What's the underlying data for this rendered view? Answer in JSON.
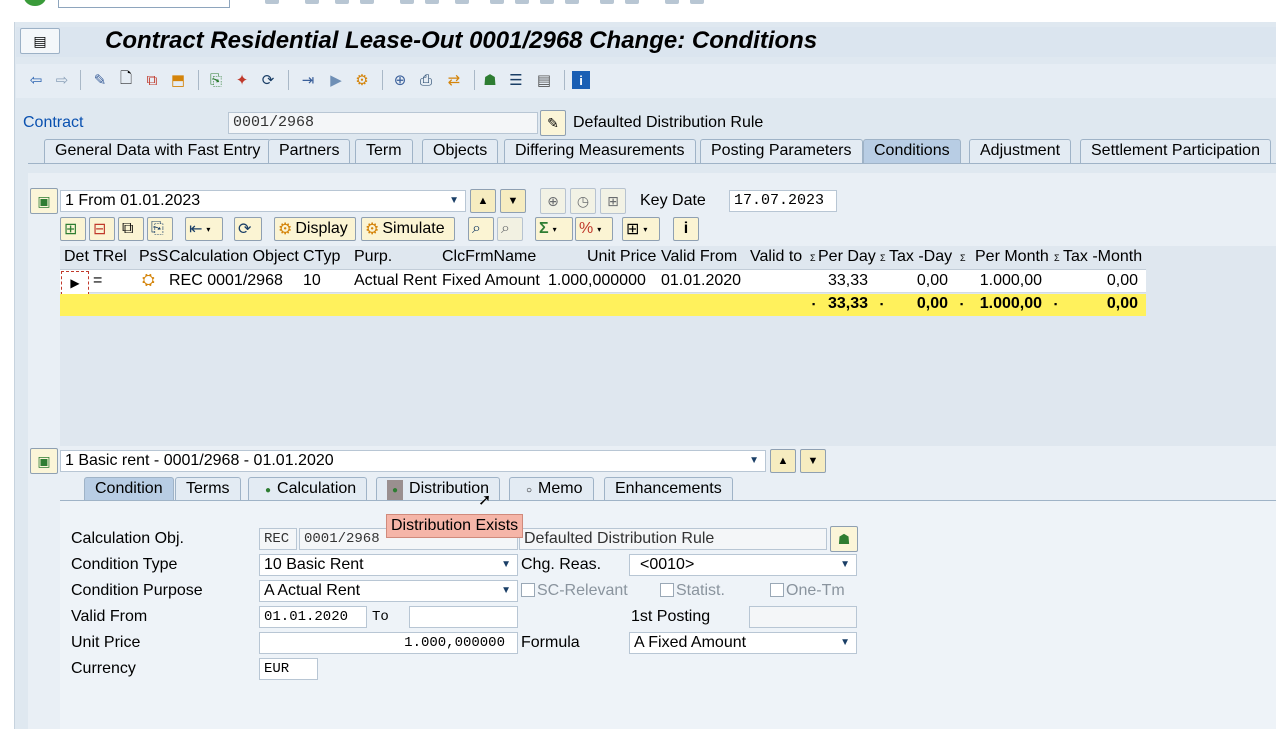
{
  "window": {
    "title": "Contract Residential Lease-Out 0001/2968 Change: Conditions"
  },
  "contract": {
    "label": "Contract",
    "number": "0001/2968",
    "distribution_rule": "Defaulted Distribution Rule"
  },
  "tabs": [
    {
      "label": "General Data with Fast Entry"
    },
    {
      "label": "Partners"
    },
    {
      "label": "Term"
    },
    {
      "label": "Objects"
    },
    {
      "label": "Differing Measurements"
    },
    {
      "label": "Posting Parameters"
    },
    {
      "label": "Conditions"
    },
    {
      "label": "Adjustment"
    },
    {
      "label": "Settlement Participation"
    }
  ],
  "period": {
    "selected": "1 From 01.01.2023",
    "key_date_label": "Key Date",
    "key_date": "17.07.2023"
  },
  "grid_toolbar": {
    "display_label": "Display",
    "simulate_label": "Simulate"
  },
  "grid": {
    "columns": [
      "Det",
      "TRel",
      "PsS",
      "Calculation Object",
      "CTyp",
      "Purp.",
      "ClcFrmName",
      "Unit Price",
      "Valid From",
      "Valid to",
      "Per Day",
      "Tax -Day",
      "Per Month",
      "Tax -Month"
    ],
    "row": {
      "trel": "=",
      "calc_object": "REC 0001/2968",
      "ctyp": "10",
      "purp": "Actual Rent",
      "clcfrm": "Fixed Amount",
      "unit_price": "1.000,000000",
      "valid_from": "01.01.2020",
      "valid_to": "",
      "per_day": "33,33",
      "tax_day": "0,00",
      "per_month": "1.000,00",
      "tax_month": "0,00"
    },
    "totals": {
      "per_day": "33,33",
      "tax_day": "0,00",
      "per_month": "1.000,00",
      "tax_month": "0,00"
    }
  },
  "condition_selector": "1 Basic rent - 0001/2968 - 01.01.2020",
  "subtabs": [
    {
      "label": "Condition"
    },
    {
      "label": "Terms"
    },
    {
      "label": "Calculation"
    },
    {
      "label": "Distribution"
    },
    {
      "label": "Memo"
    },
    {
      "label": "Enhancements"
    }
  ],
  "tooltip": "Distribution Exists",
  "form": {
    "calc_obj_label": "Calculation Obj.",
    "calc_obj_type": "REC",
    "calc_obj_number": "0001/2968",
    "distribution_rule": "Defaulted Distribution Rule",
    "cond_type_label": "Condition Type",
    "cond_type_value": "10 Basic Rent",
    "chg_reas_label": "Chg. Reas.",
    "chg_reas_value": "<0010>",
    "cond_purpose_label": "Condition Purpose",
    "cond_purpose_value": "A Actual Rent",
    "sc_relevant_label": "SC-Relevant",
    "statist_label": "Statist.",
    "one_tm_label": "One-Tm",
    "valid_from_label": "Valid From",
    "valid_from_value": "01.01.2020",
    "to_label": "To",
    "to_value": "",
    "first_posting_label": "1st Posting",
    "first_posting_value": "",
    "unit_price_label": "Unit Price",
    "unit_price_value": "1.000,000000",
    "formula_label": "Formula",
    "formula_value": "A Fixed Amount",
    "currency_label": "Currency",
    "currency_value": "EUR"
  }
}
